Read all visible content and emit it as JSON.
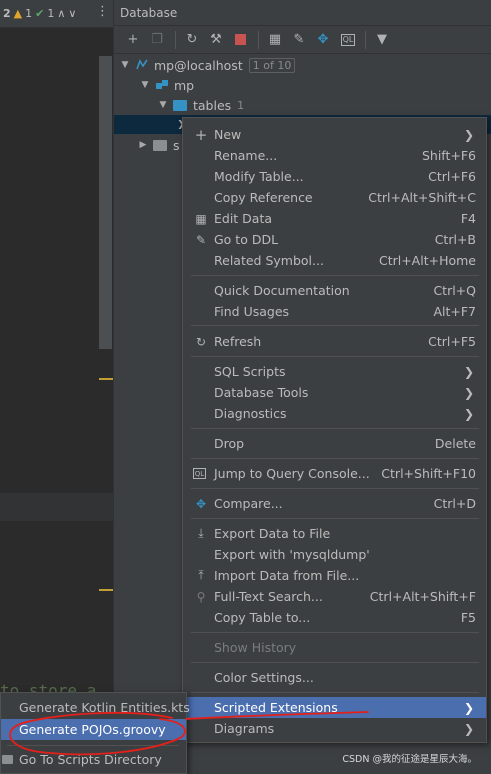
{
  "editor": {
    "inspection_counts": [
      "2",
      "1",
      "1"
    ],
    "ghost_code": "to store a"
  },
  "panel": {
    "title": "Database",
    "more_icon": "vertical-dots-icon"
  },
  "toolbar": {
    "icons": [
      "add-icon",
      "copy-icon",
      "refresh-icon",
      "schema-icon",
      "stop-icon",
      "table-icon",
      "edit-icon",
      "compare-icon",
      "query-console-icon",
      "filter-icon"
    ],
    "stop_color": "#c75450"
  },
  "tree": {
    "datasource": {
      "label": "mp@localhost",
      "count": "1 of 10"
    },
    "schema": {
      "label": "mp"
    },
    "tables": {
      "label": "tables",
      "count": "1"
    },
    "partial_item": "s"
  },
  "context_menu": {
    "items": [
      {
        "label": "New",
        "shortcut": "",
        "submenu": true,
        "icon": "plus-icon"
      },
      {
        "label": "Rename...",
        "shortcut": "Shift+F6"
      },
      {
        "label": "Modify Table...",
        "shortcut": "Ctrl+F6"
      },
      {
        "label": "Copy Reference",
        "shortcut": "Ctrl+Alt+Shift+C"
      },
      {
        "label": "Edit Data",
        "shortcut": "F4",
        "icon": "table-grid-icon"
      },
      {
        "label": "Go to DDL",
        "shortcut": "Ctrl+B",
        "icon": "pencil-icon"
      },
      {
        "label": "Related Symbol...",
        "shortcut": "Ctrl+Alt+Home"
      },
      {
        "label": "Quick Documentation",
        "shortcut": "Ctrl+Q"
      },
      {
        "label": "Find Usages",
        "shortcut": "Alt+F7"
      },
      {
        "label": "Refresh",
        "shortcut": "Ctrl+F5",
        "icon": "refresh-icon"
      },
      {
        "label": "SQL Scripts",
        "submenu": true
      },
      {
        "label": "Database Tools",
        "submenu": true
      },
      {
        "label": "Diagnostics",
        "submenu": true
      },
      {
        "label": "Drop",
        "shortcut": "Delete"
      },
      {
        "label": "Jump to Query Console...",
        "shortcut": "Ctrl+Shift+F10",
        "icon": "query-console-icon"
      },
      {
        "label": "Compare...",
        "shortcut": "Ctrl+D",
        "icon": "compare-icon"
      },
      {
        "label": "Export Data to File",
        "icon": "export-icon"
      },
      {
        "label": "Export with 'mysqldump'"
      },
      {
        "label": "Import Data from File...",
        "icon": "import-icon"
      },
      {
        "label": "Full-Text Search...",
        "shortcut": "Ctrl+Alt+Shift+F",
        "icon": "search-icon"
      },
      {
        "label": "Copy Table to...",
        "shortcut": "F5"
      },
      {
        "label": "Show History",
        "disabled": true
      },
      {
        "label": "Color Settings..."
      },
      {
        "label": "Scripted Extensions",
        "submenu": true,
        "active": true
      },
      {
        "label": "Diagrams",
        "submenu": true
      }
    ]
  },
  "submenu": {
    "items": [
      {
        "label": "Generate Kotlin Entities.kts"
      },
      {
        "label": "Generate POJOs.groovy",
        "active": true
      },
      {
        "label": "Go To Scripts Directory",
        "icon": "folder-icon"
      }
    ]
  },
  "watermark": "CSDN @我的征途是星辰大海。",
  "colors": {
    "selection": "#4b6eaf",
    "annotation": "#e3201b",
    "folder": "#3592c4"
  }
}
